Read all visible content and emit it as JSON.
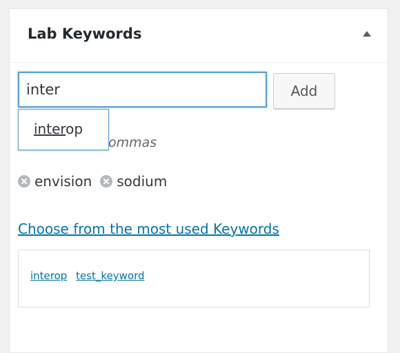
{
  "panel": {
    "title": "Lab Keywords",
    "toggle_icon": "triangle-up-icon"
  },
  "input": {
    "value": "inter",
    "placeholder": ""
  },
  "add_button": {
    "label": "Add"
  },
  "suggestion": {
    "match": "inter",
    "rest": "op"
  },
  "hint": {
    "visible_text": "ywords with commas"
  },
  "tags": [
    {
      "label": "envision",
      "remove_icon": "remove-circle-icon"
    },
    {
      "label": "sodium",
      "remove_icon": "remove-circle-icon"
    }
  ],
  "most_used": {
    "link_text": "Choose from the most used Keywords",
    "cloud": [
      {
        "label": "interop"
      },
      {
        "label": "test_keyword"
      }
    ]
  },
  "colors": {
    "accent": "#0073aa",
    "focus_border": "#5b9dd9"
  }
}
